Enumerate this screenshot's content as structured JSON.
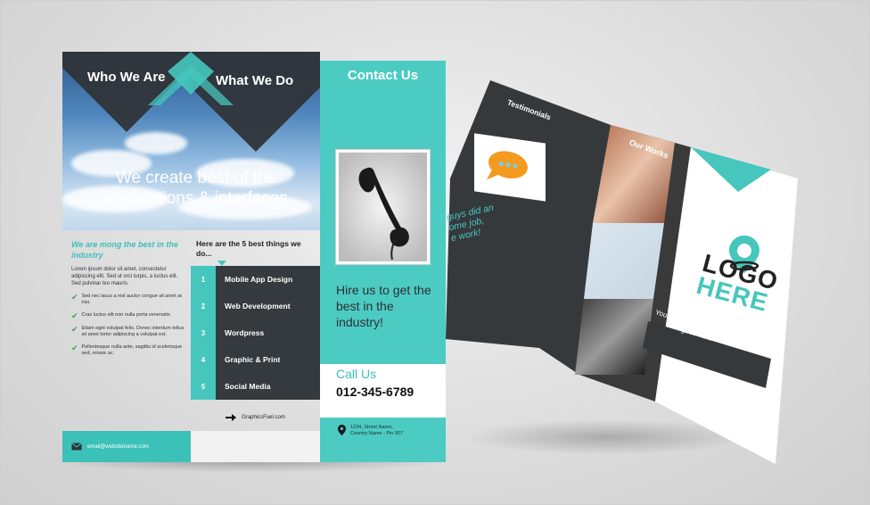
{
  "brochure_front": {
    "panel1_heading": "Who We Are",
    "panel2_heading": "What We Do",
    "panel3_heading": "Contact Us",
    "tagline_line1": "We create best of the",
    "tagline_line2": "applications & interfaces",
    "left_subheading": "We are mong the best in the industry",
    "left_paragraph": "Lorem ipsum dolor sit amet, consectetur adipiscing elit. Sed ut orci turpis, a luctus elit. Sed pulvinar leo mauris.",
    "checklist": [
      "Sed nec lacus a nisl auctor congue sit amet at nisi.",
      "Cras luctus elit non nulla porta venenatis.",
      "Etiam eget volutpat felis. Donec interdum tellus sit amet tortor adipiscing a volutpat est.",
      "Pellentesque nulla ante, sagittis id scelerisque sed, ornare ac."
    ],
    "email": "email@websitename.com",
    "mid_heading": "Here are the 5 best things we do...",
    "services": [
      {
        "num": "1",
        "label": "Mobile App Design"
      },
      {
        "num": "2",
        "label": "Web Development"
      },
      {
        "num": "3",
        "label": "Wordpress"
      },
      {
        "num": "4",
        "label": "Graphic & Print"
      },
      {
        "num": "5",
        "label": "Social Media"
      }
    ],
    "website": "GraphicsFuel.com",
    "hire_text": "Hire us to get the best in the industry!",
    "call_label": "Call Us",
    "phone": "012-345-6789",
    "address_line1": "1234, Street Name,",
    "address_line2": "Country Name - Pin 007"
  },
  "brochure_back": {
    "testimonials_heading": "Testimonials",
    "works_heading": "Our Works",
    "quote_fragment_1": "guys did an",
    "quote_fragment_2": "ome job,",
    "quote_fragment_3": "e work!",
    "logo_top": "LOGO",
    "logo_bottom": "HERE",
    "caption": "Your short and sweet caption goes here"
  },
  "colors": {
    "teal": "#3cc1b9",
    "dark": "#353a3e",
    "white": "#ffffff"
  }
}
